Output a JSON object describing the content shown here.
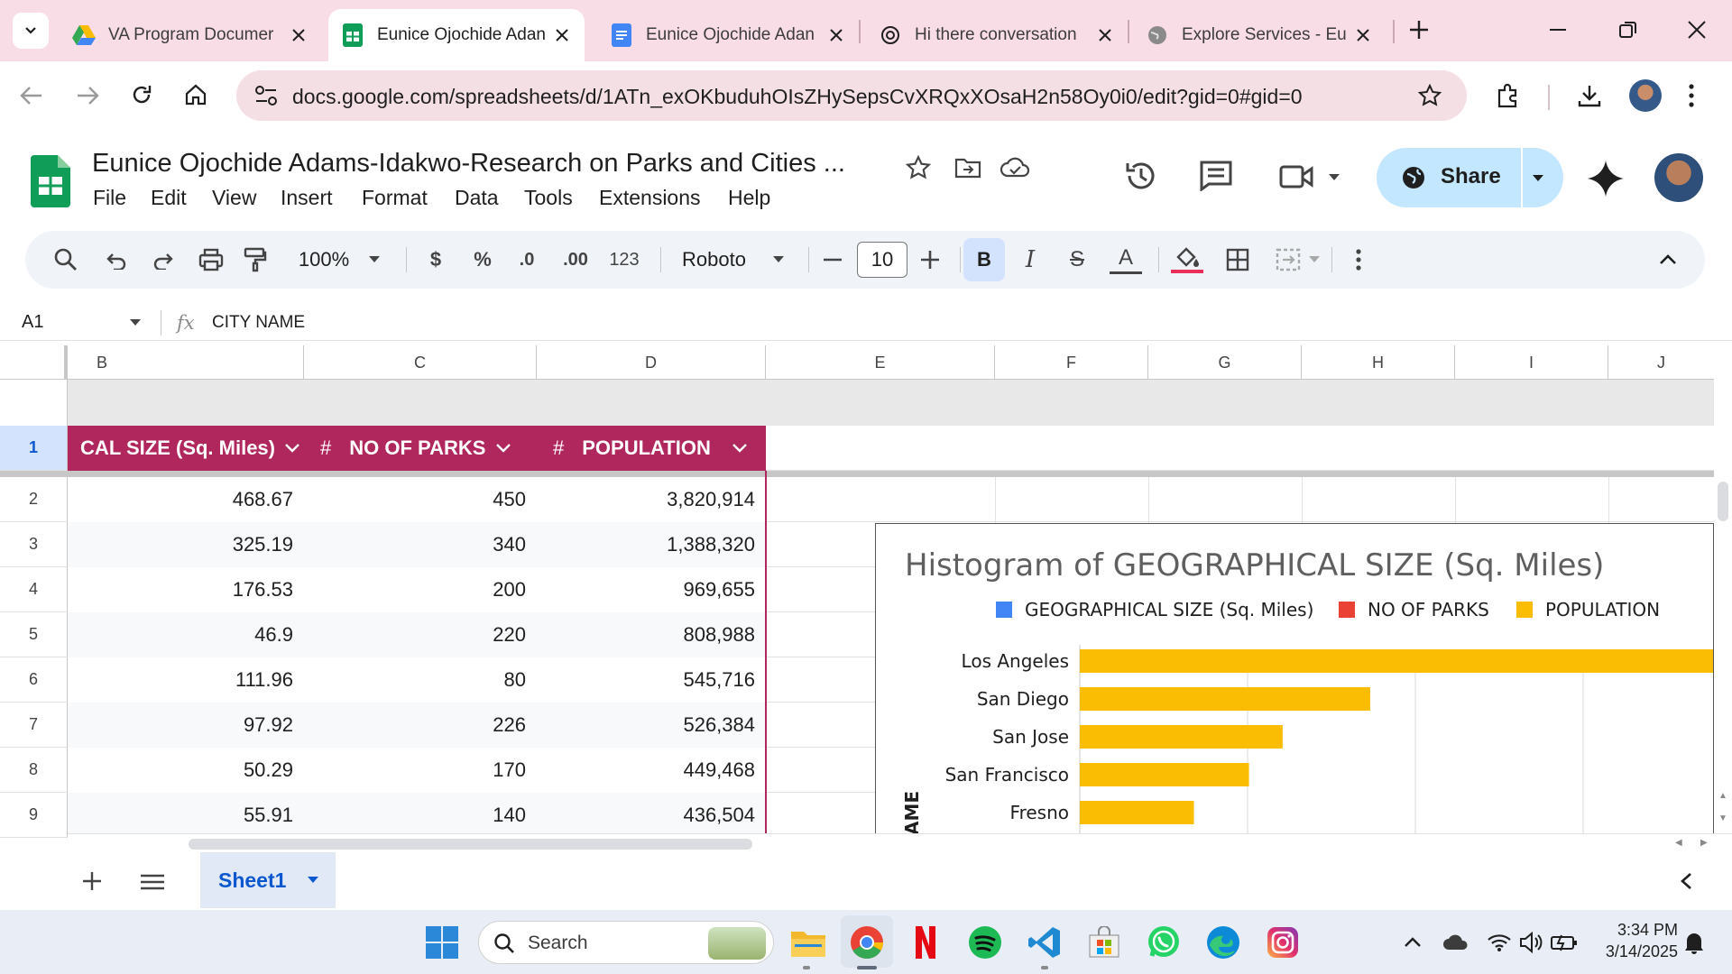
{
  "browser": {
    "tabs": [
      {
        "title": "VA Program Documer",
        "icon": "google-drive-icon",
        "active": false
      },
      {
        "title": "Eunice Ojochide Adan",
        "icon": "google-sheets-icon",
        "active": true
      },
      {
        "title": "Eunice Ojochide Adan",
        "icon": "google-docs-icon",
        "active": false
      },
      {
        "title": "Hi there conversation",
        "icon": "openai-icon",
        "active": false
      },
      {
        "title": "Explore Services - Eur",
        "icon": "globe-icon",
        "active": false
      }
    ],
    "url": "docs.google.com/spreadsheets/d/1ATn_exOKbuduhOIsZHySepsCvXRQxXOsaH2n58Oy0i0/edit?gid=0#gid=0"
  },
  "app": {
    "title": "Eunice Ojochide Adams-Idakwo-Research on Parks and Cities ...",
    "menu": [
      "File",
      "Edit",
      "View",
      "Insert",
      "Format",
      "Data",
      "Tools",
      "Extensions",
      "Help"
    ],
    "share_label": "Share"
  },
  "toolbar": {
    "zoom": "100%",
    "currency": "$",
    "percent": "%",
    "dec_decrease": ".0",
    "dec_increase": ".00",
    "number_format": "123",
    "font": "Roboto",
    "font_size": "10",
    "bold": "B",
    "italic": "I",
    "strike": "S",
    "text_color": "A"
  },
  "formula_bar": {
    "cell_ref": "A1",
    "fx": "fx",
    "value": "CITY NAME"
  },
  "grid": {
    "columns": [
      "B",
      "C",
      "D",
      "E",
      "F",
      "G",
      "H",
      "I",
      "J"
    ],
    "header_row_number": "1",
    "headers": [
      {
        "icon": "",
        "label": "CAL SIZE (Sq. Miles)"
      },
      {
        "icon": "#",
        "label": "NO OF PARKS"
      },
      {
        "icon": "#",
        "label": "POPULATION"
      }
    ],
    "rows": [
      {
        "num": "2",
        "size": "468.67",
        "parks": "450",
        "population": "3,820,914"
      },
      {
        "num": "3",
        "size": "325.19",
        "parks": "340",
        "population": "1,388,320"
      },
      {
        "num": "4",
        "size": "176.53",
        "parks": "200",
        "population": "969,655"
      },
      {
        "num": "5",
        "size": "46.9",
        "parks": "220",
        "population": "808,988"
      },
      {
        "num": "6",
        "size": "111.96",
        "parks": "80",
        "population": "545,716"
      },
      {
        "num": "7",
        "size": "97.92",
        "parks": "226",
        "population": "526,384"
      },
      {
        "num": "8",
        "size": "50.29",
        "parks": "170",
        "population": "449,468"
      },
      {
        "num": "9",
        "size": "55.91",
        "parks": "140",
        "population": "436,504"
      }
    ]
  },
  "chart_data": {
    "type": "bar",
    "orientation": "horizontal",
    "title": "Histogram of GEOGRAPHICAL SIZE (Sq. Miles)",
    "legend_position": "top",
    "legend": [
      {
        "name": "GEOGRAPHICAL SIZE (Sq. Miles)",
        "color": "#4285f4"
      },
      {
        "name": "NO OF PARKS",
        "color": "#ea4335"
      },
      {
        "name": "POPULATION",
        "color": "#fbbc04"
      }
    ],
    "ylabel_partial": "AME",
    "categories": [
      "Los Angeles",
      "San Diego",
      "San Jose",
      "San Francisco",
      "Fresno"
    ],
    "series": [
      {
        "name": "POPULATION",
        "color": "#fbbc04",
        "values": [
          3820914,
          1388320,
          969655,
          808988,
          545716
        ]
      }
    ],
    "grid": true
  },
  "sheet_tabs": {
    "active": "Sheet1"
  },
  "taskbar": {
    "search_label": "Search",
    "time": "3:34 PM",
    "date": "3/14/2025",
    "apps": [
      "file-explorer-icon",
      "chrome-icon",
      "netflix-icon",
      "spotify-icon",
      "vscode-icon",
      "microsoft-store-icon",
      "whatsapp-icon",
      "edge-icon",
      "instagram-icon"
    ]
  }
}
